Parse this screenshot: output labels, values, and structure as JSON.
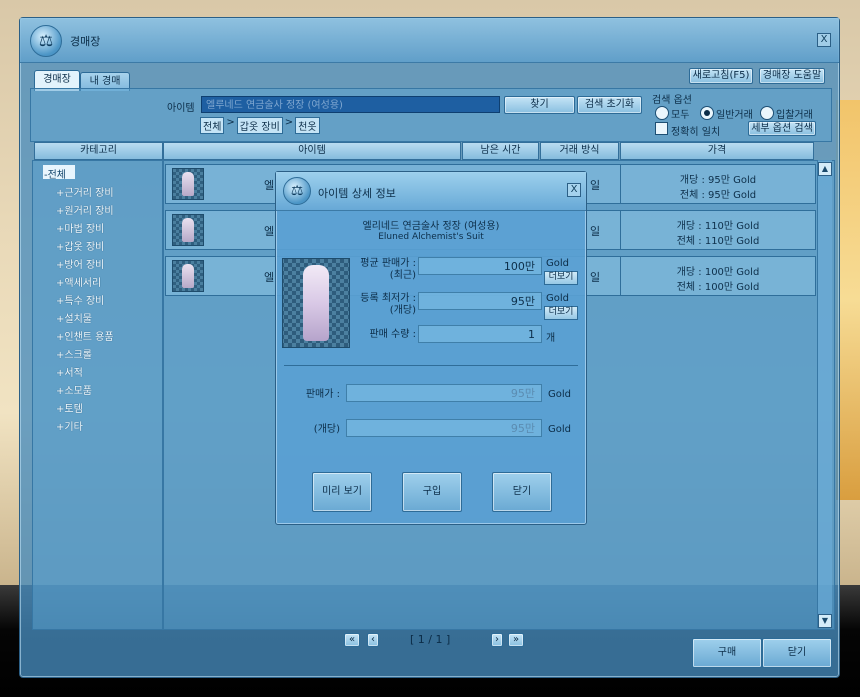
{
  "window": {
    "title": "경매장",
    "close_label": "X"
  },
  "tabs": [
    {
      "label": "경매장",
      "active": true
    },
    {
      "label": "내 경매",
      "active": false
    }
  ],
  "top_buttons": {
    "refresh": "새로고침(F5)",
    "help": "경매장 도움말"
  },
  "search": {
    "label": "아이템",
    "input_value": "엘루네드 연금술사 정장 (여성용)",
    "find": "찾기",
    "reset": "검색 초기화",
    "breadcrumb": [
      "전체",
      ">",
      "갑옷 장비",
      ">",
      "천옷"
    ],
    "options_title": "검색 옵션",
    "radio_all": "모두",
    "radio_general": "일반거래",
    "radio_bid": "입찰거래",
    "exact_match": "정확히 일치",
    "detail_search": "세부 옵션 검색"
  },
  "category": {
    "header": "카테고리",
    "items": [
      "-전체",
      "+근거리 장비",
      "+원거리 장비",
      "+마법 장비",
      "+갑옷 장비",
      "+방어 장비",
      "+액세서리",
      "+특수 장비",
      "+설치물",
      "+인챈트 용품",
      "+스크롤",
      "+서적",
      "+소모품",
      "+토템",
      "+기타"
    ]
  },
  "list": {
    "headers": {
      "item": "아이템",
      "time_left": "남은 시간",
      "trade_type": "거래 방식",
      "price": "가격"
    },
    "rows": [
      {
        "name_prefix": "엘",
        "trade_prefix": "일",
        "price_each": "개당 : 95만 Gold",
        "price_total": "전체 : 95만 Gold"
      },
      {
        "name_prefix": "엘",
        "trade_prefix": "일",
        "price_each": "개당 : 110만 Gold",
        "price_total": "전체 : 110만 Gold"
      },
      {
        "name_prefix": "엘",
        "trade_prefix": "일",
        "price_each": "개당 : 100만 Gold",
        "price_total": "전체 : 100만 Gold"
      }
    ]
  },
  "pager": {
    "first": "«",
    "prev": "‹",
    "page": "[ 1 / 1 ]",
    "next": "›",
    "last": "»"
  },
  "bottom_buttons": {
    "buy": "구매",
    "close": "닫기"
  },
  "modal": {
    "title": "아이템 상세 정보",
    "close_label": "X",
    "item_name_kr": "엘리네드 연금술사 정장 (여성용)",
    "item_name_en": "Eluned Alchemist's Suit",
    "avg_price_label_1": "평균 판매가 :",
    "avg_price_label_2": "(최근)",
    "avg_price": "100만",
    "registered_min_label_1": "등록 최저가 :",
    "registered_min_label_2": "(개당)",
    "registered_min": "95만",
    "sale_qty_label": "판매 수량 :",
    "sale_qty": "1",
    "gold": "Gold",
    "qty_unit": "개",
    "more": "더보기",
    "sell_price_label": "판매가 :",
    "sell_price": "95만",
    "unit_price_label": "(개당)",
    "unit_price": "95만",
    "preview": "미리 보기",
    "buy": "구입",
    "close": "닫기"
  }
}
